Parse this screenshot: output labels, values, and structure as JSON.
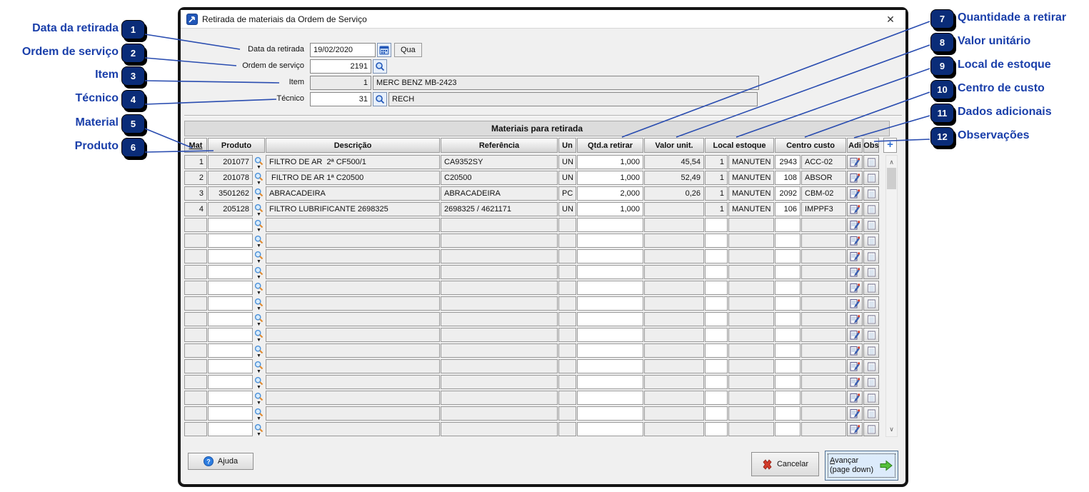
{
  "window": {
    "title": "Retirada de materiais da Ordem de Serviço",
    "close_glyph": "✕"
  },
  "form": {
    "date": {
      "label": "Data da retirada",
      "value": "19/02/2020",
      "weekday": "Qua"
    },
    "order": {
      "label": "Ordem de serviço",
      "value": "2191"
    },
    "item": {
      "label": "Item",
      "number": "1",
      "description": "MERC BENZ MB-2423"
    },
    "technician": {
      "label": "Técnico",
      "number": "31",
      "description": "RECH"
    }
  },
  "table": {
    "group_title": "Materiais para retirada",
    "columns": [
      "Mat",
      "Produto",
      "Descrição",
      "Referência",
      "Un",
      "Qtd.a retirar",
      "Valor unit.",
      "Local estoque",
      "Centro custo",
      "Adi",
      "Obs"
    ],
    "add_label": "+",
    "visible_rows": 18,
    "rows": [
      {
        "mat": "1",
        "produto": "201077",
        "descricao": "FILTRO DE AR  2ª CF500/1",
        "referencia": "CA9352SY",
        "un": "UN",
        "qtd": "1,000",
        "valor": "45,54",
        "local_num": "1",
        "local_nome": "MANUTEN",
        "centro_num": "2943",
        "centro_nome": "ACC-02"
      },
      {
        "mat": "2",
        "produto": "201078",
        "descricao": " FILTRO DE AR 1ª C20500",
        "referencia": "C20500",
        "un": "UN",
        "qtd": "1,000",
        "valor": "52,49",
        "local_num": "1",
        "local_nome": "MANUTEN",
        "centro_num": "108",
        "centro_nome": "ABSOR"
      },
      {
        "mat": "3",
        "produto": "3501262",
        "descricao": "ABRACADEIRA",
        "referencia": "ABRACADEIRA",
        "un": "PC",
        "qtd": "2,000",
        "valor": "0,26",
        "local_num": "1",
        "local_nome": "MANUTEN",
        "centro_num": "2092",
        "centro_nome": "CBM-02"
      },
      {
        "mat": "4",
        "produto": "205128",
        "descricao": "FILTRO LUBRIFICANTE 2698325",
        "referencia": "2698325 / 4621171",
        "un": "UN",
        "qtd": "1,000",
        "valor": "",
        "local_num": "1",
        "local_nome": "MANUTEN",
        "centro_num": "106",
        "centro_nome": "IMPPF3"
      }
    ]
  },
  "footer": {
    "help": "Ajuda",
    "cancel": "Cancelar",
    "advance_line1": "Avançar",
    "advance_line2": "(page down)"
  },
  "callouts": {
    "left": [
      {
        "num": "1",
        "label": "Data da retirada"
      },
      {
        "num": "2",
        "label": "Ordem de serviço"
      },
      {
        "num": "3",
        "label": "Item"
      },
      {
        "num": "4",
        "label": "Técnico"
      },
      {
        "num": "5",
        "label": "Material"
      },
      {
        "num": "6",
        "label": "Produto"
      }
    ],
    "right": [
      {
        "num": "7",
        "label": "Quantidade a retirar"
      },
      {
        "num": "8",
        "label": "Valor unitário"
      },
      {
        "num": "9",
        "label": "Local de estoque"
      },
      {
        "num": "10",
        "label": "Centro de custo"
      },
      {
        "num": "11",
        "label": "Dados adicionais"
      },
      {
        "num": "12",
        "label": "Observações"
      }
    ]
  }
}
